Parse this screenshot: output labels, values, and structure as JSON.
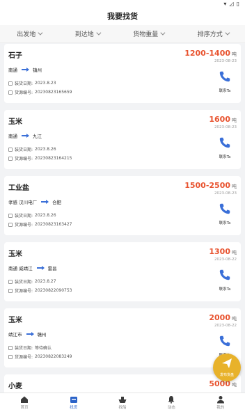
{
  "header": {
    "title": "我要找货"
  },
  "filters": [
    {
      "label": "出发地"
    },
    {
      "label": "到达地"
    },
    {
      "label": "货物重量"
    },
    {
      "label": "排序方式"
    }
  ],
  "cards": [
    {
      "goods": "石子",
      "price": "1200-1400",
      "unit": "吨",
      "date": "2023-08-23",
      "from": "南通",
      "to": "镇州",
      "ship_date_label": "装货日期:",
      "ship_date": "2023.8.23",
      "source_no_label": "货源编号:",
      "source_no": "20230823165659",
      "contact": "联系Ta"
    },
    {
      "goods": "玉米",
      "price": "1600",
      "unit": "吨",
      "date": "2023-08-23",
      "from": "南通",
      "to": "九江",
      "ship_date_label": "装货日期:",
      "ship_date": "2023.8.26",
      "source_no_label": "货源编号:",
      "source_no": "20230823164215",
      "contact": "联系Ta"
    },
    {
      "goods": "工业盐",
      "price": "1500-2500",
      "unit": "吨",
      "date": "2023-08-23",
      "from": "孝感 汉川电厂",
      "to": "合肥",
      "ship_date_label": "装货日期:",
      "ship_date": "2023.8.26",
      "source_no_label": "货源编号:",
      "source_no": "20230823163427",
      "contact": "联系Ta"
    },
    {
      "goods": "玉米",
      "price": "1300",
      "unit": "吨",
      "date": "2023-08-22",
      "from": "南通 威靖江",
      "to": "雷昌",
      "ship_date_label": "装货日期:",
      "ship_date": "2023.8.27",
      "source_no_label": "货源编号:",
      "source_no": "20230822090753",
      "contact": "联系Ta"
    },
    {
      "goods": "玉米",
      "price": "2000",
      "unit": "吨",
      "date": "2023-08-22",
      "from": "靖江市",
      "to": "赣州",
      "ship_date_label": "装货日期:",
      "ship_date": "等待确认",
      "source_no_label": "货源编号:",
      "source_no": "20230822083249",
      "contact": "联系Ta"
    },
    {
      "goods": "小麦",
      "price": "5000",
      "unit": "吨"
    }
  ],
  "fab": {
    "label": "发布货盘"
  },
  "tabs": [
    {
      "label": "首页",
      "icon": "home-icon"
    },
    {
      "label": "找货",
      "icon": "cargo-icon",
      "active": true
    },
    {
      "label": "找船",
      "icon": "ship-icon"
    },
    {
      "label": "动态",
      "icon": "bell-icon"
    },
    {
      "label": "我的",
      "icon": "user-icon"
    }
  ]
}
